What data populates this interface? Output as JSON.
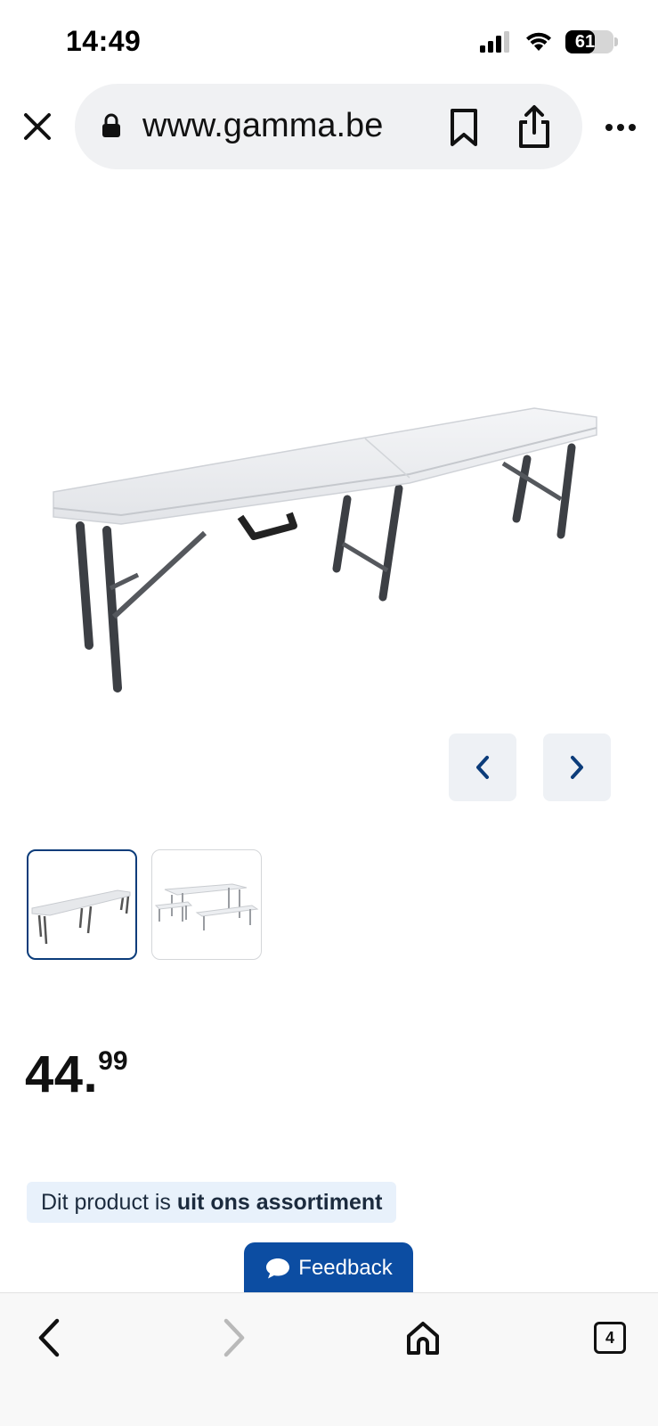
{
  "status_bar": {
    "time": "14:49",
    "battery_level": "61",
    "battery_fraction": 0.61,
    "icons": [
      "signal-icon",
      "wifi-icon",
      "battery-icon"
    ]
  },
  "browser": {
    "url": "www.gamma.be",
    "icons": [
      "close-icon",
      "lock-icon",
      "bookmark-icon",
      "share-icon",
      "more-icon"
    ]
  },
  "product": {
    "image": "folding-bench-image",
    "thumbnails": [
      "folding-bench-thumbnail",
      "picnic-set-thumbnail"
    ],
    "selected_thumbnail": 0,
    "price_whole": "44.",
    "price_cents": "99"
  },
  "notice": {
    "text_regular": "Dit product is",
    "text_bold": "uit ons assortiment"
  },
  "feedback": {
    "label": "Feedback",
    "color": "#0c4da2"
  },
  "toolbar": {
    "tab_count": "4",
    "icons": [
      "back-icon",
      "forward-icon",
      "home-icon",
      "tabs-icon"
    ]
  },
  "colors": {
    "brand_blue": "#0c4da2",
    "thumb_selected_border": "#0b3c7a",
    "notice_bg": "#e8f1fb",
    "carousel_btn_bg": "#eef1f5"
  }
}
